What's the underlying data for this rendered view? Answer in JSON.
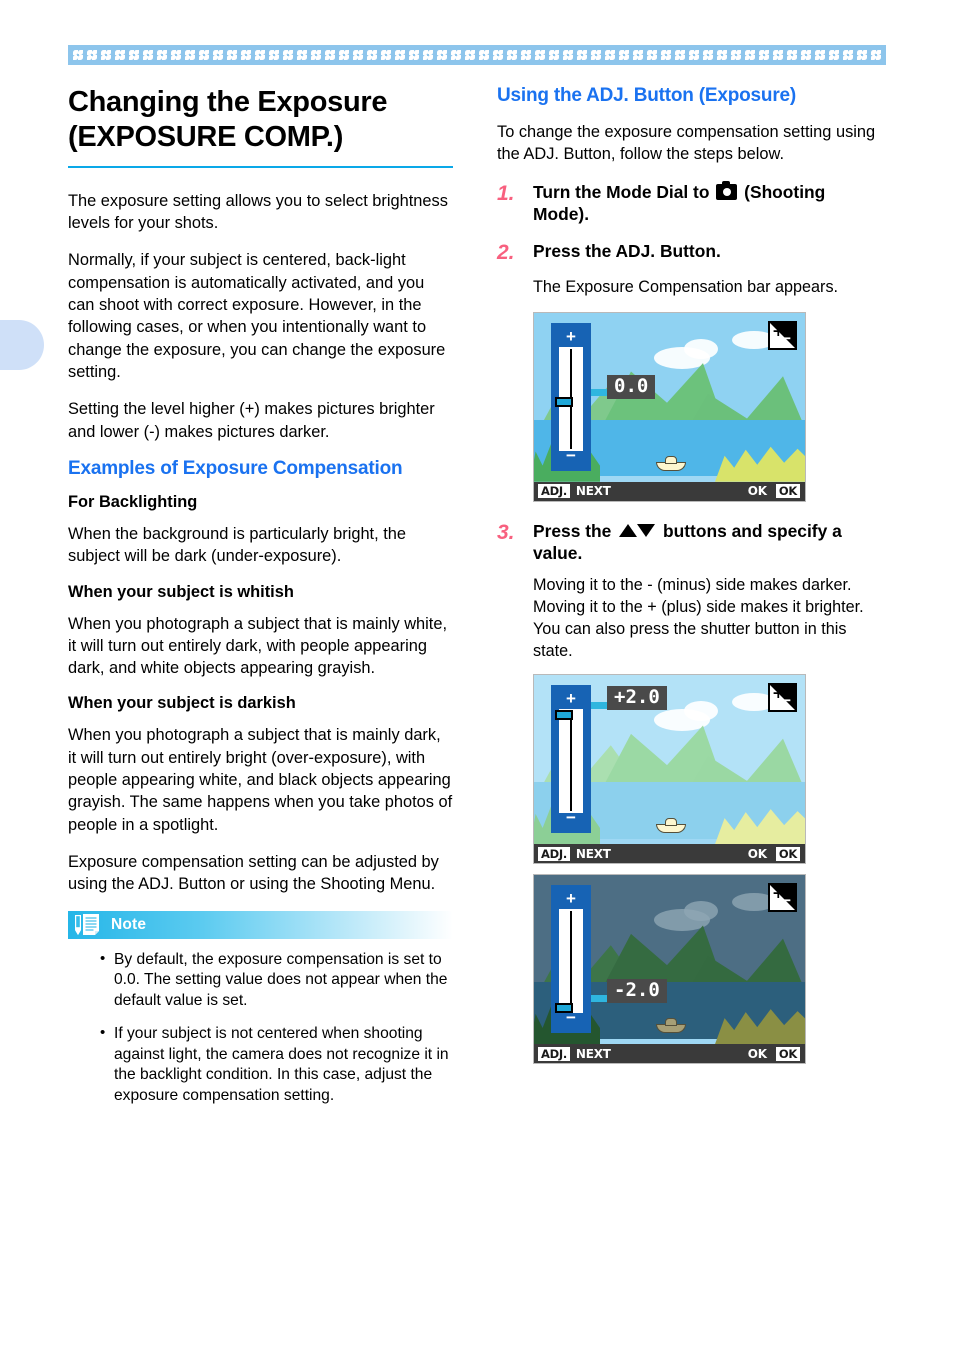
{
  "decor": {
    "band_color": "#8dc5ec",
    "floret_count": 58,
    "thumb_tab_color": "#cfe0f8",
    "rule_color": "#0aa8e8",
    "heading_blue": "#1a72f0",
    "step_number_pink": "#f8607f"
  },
  "left": {
    "title_line1": "Changing the Exposure",
    "title_line2": "(EXPOSURE COMP.)",
    "paragraphs": [
      "The exposure setting allows you to select brightness levels for your shots.",
      "Normally, if your subject is centered, back-light compensation is automatically activated, and you can shoot with correct exposure. However, in the following cases, or when you intentionally want to change the exposure, you can change the exposure setting.",
      "Setting the level higher (+) makes pictures brighter and lower (-) makes pictures darker."
    ],
    "examples_heading": "Examples of Exposure Compensation",
    "sections": [
      {
        "head": "For Backlighting",
        "body": "When the background is particularly bright, the subject will be dark (under-exposure)."
      },
      {
        "head": "When your subject is whitish",
        "body": "When you photograph a subject that is mainly white, it will turn out entirely dark, with people appearing dark, and white objects appearing grayish."
      },
      {
        "head": "When your subject is darkish",
        "body": "When you photograph a subject that is mainly dark, it will turn out entirely bright (over-exposure), with people appearing white, and black objects appearing grayish. The same happens when you take photos of people in a spotlight."
      }
    ],
    "closing_paragraph": "Exposure compensation setting can be adjusted by using the ADJ. Button or using the Shooting Menu.",
    "note": {
      "label": "Note",
      "icon": "note-pad-pencil-icon",
      "bullets": [
        "By default, the exposure compensation is set to 0.0. The setting value does not appear when the default value is set.",
        "If your subject is not centered when shooting against light, the camera does not recognize it in the backlight condition. In this case, adjust the exposure compensation setting."
      ]
    }
  },
  "right": {
    "heading": "Using the ADJ. Button (Exposure)",
    "intro": "To change the exposure compensation setting using the ADJ. Button, follow the steps below.",
    "steps": [
      {
        "number": "1.",
        "text_before": "Turn the Mode Dial to",
        "icon": "camera-icon",
        "text_after": "(Shooting Mode)."
      },
      {
        "number": "2.",
        "text_before": "Press the ADJ. Button.",
        "icon": "",
        "text_after": "",
        "body": "The Exposure Compensation bar appears."
      },
      {
        "number": "3.",
        "text_before": "Press the",
        "icon": "up-down-arrow-icons",
        "text_after": "buttons and specify a value.",
        "body": "Moving it to the - (minus) side makes darker. Moving it to the + (plus) side makes it brighter. You can also press the shutter button in this state."
      }
    ],
    "screens": [
      {
        "id": "lcd-screen-0",
        "value": "0.0",
        "handle_position_percent": 50,
        "brightness": "normal",
        "ev_icon": "exposure-compensation-icon",
        "bar_left_chip": "ADJ.",
        "bar_left_text": "NEXT",
        "bar_right_text": "OK",
        "bar_right_chip": "OK"
      },
      {
        "id": "lcd-screen-plus2",
        "value": "+2.0",
        "handle_position_percent": 5,
        "brightness": "bright",
        "ev_icon": "exposure-compensation-icon",
        "bar_left_chip": "ADJ.",
        "bar_left_text": "NEXT",
        "bar_right_text": "OK",
        "bar_right_chip": "OK"
      },
      {
        "id": "lcd-screen-minus2",
        "value": "-2.0",
        "handle_position_percent": 88,
        "brightness": "dark",
        "ev_icon": "exposure-compensation-icon",
        "bar_left_chip": "ADJ.",
        "bar_left_text": "NEXT",
        "bar_right_text": "OK",
        "bar_right_chip": "OK"
      }
    ],
    "slider_plus": "+",
    "slider_minus": "−"
  }
}
